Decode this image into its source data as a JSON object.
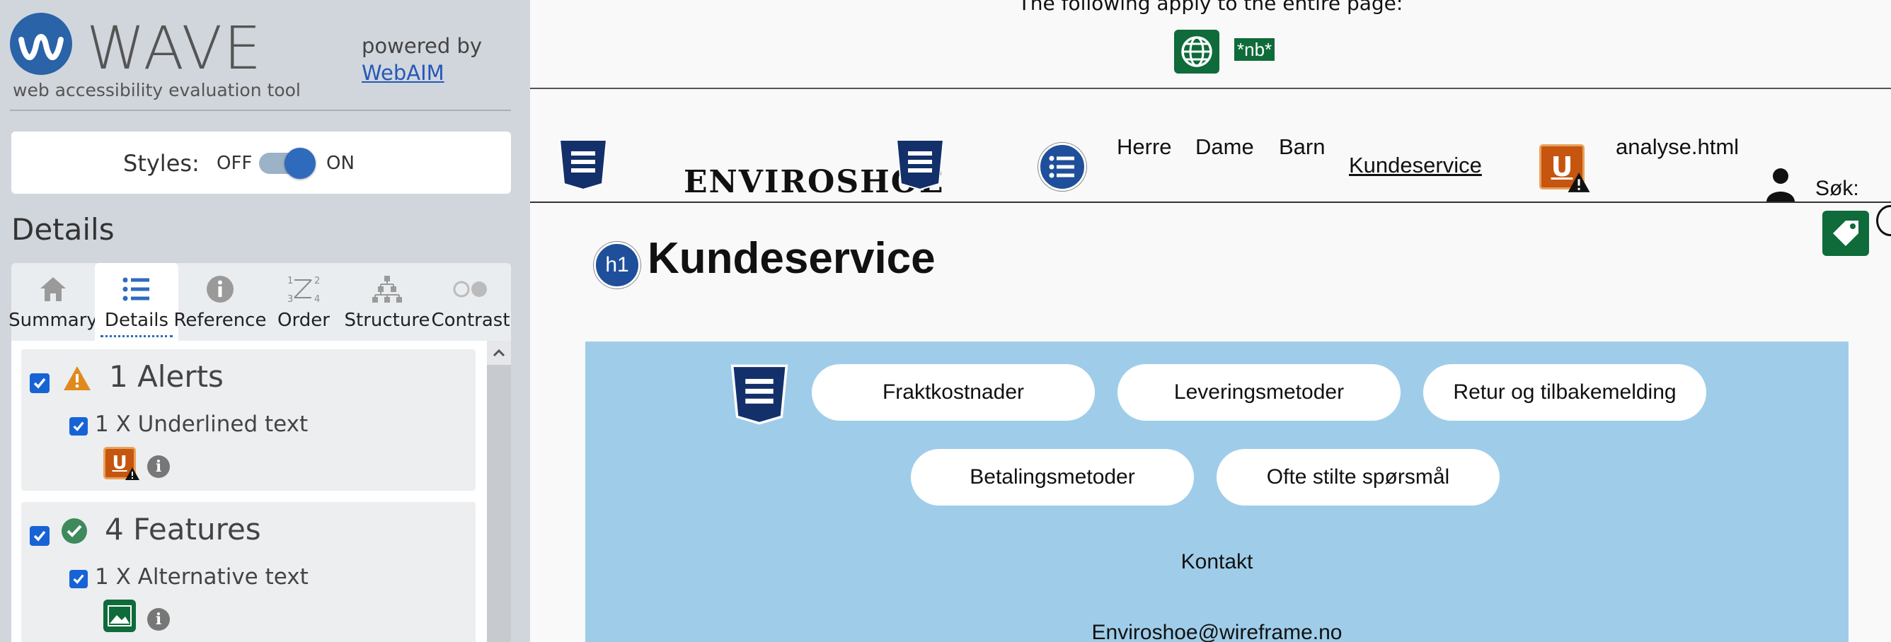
{
  "sidebar": {
    "brand": "WAVE",
    "tagline": "web accessibility evaluation tool",
    "powered_by": "powered by",
    "powered_link": "WebAIM",
    "styles": {
      "label": "Styles:",
      "off": "OFF",
      "on": "ON",
      "state": "on"
    },
    "details_title": "Details",
    "tabs": [
      {
        "label": "Summary",
        "icon": "home-icon",
        "active": false
      },
      {
        "label": "Details",
        "icon": "list-icon",
        "active": true
      },
      {
        "label": "Reference",
        "icon": "info-icon",
        "active": false
      },
      {
        "label": "Order",
        "icon": "order-icon",
        "active": false
      },
      {
        "label": "Structure",
        "icon": "structure-icon",
        "active": false
      },
      {
        "label": "Contrast",
        "icon": "contrast-icon",
        "active": false
      }
    ],
    "alerts": {
      "heading": "1 Alerts",
      "items": [
        {
          "label": "1 X Underlined text",
          "icon": "underline-alert-icon"
        }
      ]
    },
    "features": {
      "heading": "4 Features",
      "items": [
        {
          "label": "1 X Alternative text",
          "icon": "alt-text-icon"
        }
      ]
    }
  },
  "page": {
    "note": "The following apply to the entire page:",
    "lang_badge": "*nb*",
    "brand": "ENVIROSHOE",
    "nav": [
      "Herre",
      "Dame",
      "Barn"
    ],
    "nav_active": "Kundeservice",
    "analyse_link": "analyse.html",
    "search_label": "Søk:",
    "h1_badge": "h1",
    "heading": "Kundeservice",
    "buttons_row1": [
      "Fraktkostnader",
      "Leveringsmetoder",
      "Retur og tilbakemelding"
    ],
    "buttons_row2": [
      "Betalingsmetoder",
      "Ofte stilte spørsmål"
    ],
    "contact_heading": "Kontakt",
    "contact_email": "Enviroshoe@wireframe.no"
  },
  "colors": {
    "wave_blue": "#2a63a8",
    "sidebar_bg": "#d1d6dd",
    "feature_green": "#0f6b3a",
    "alert_orange": "#c5550f",
    "css_navy": "#14306b",
    "content_blue": "#9fcde9"
  }
}
